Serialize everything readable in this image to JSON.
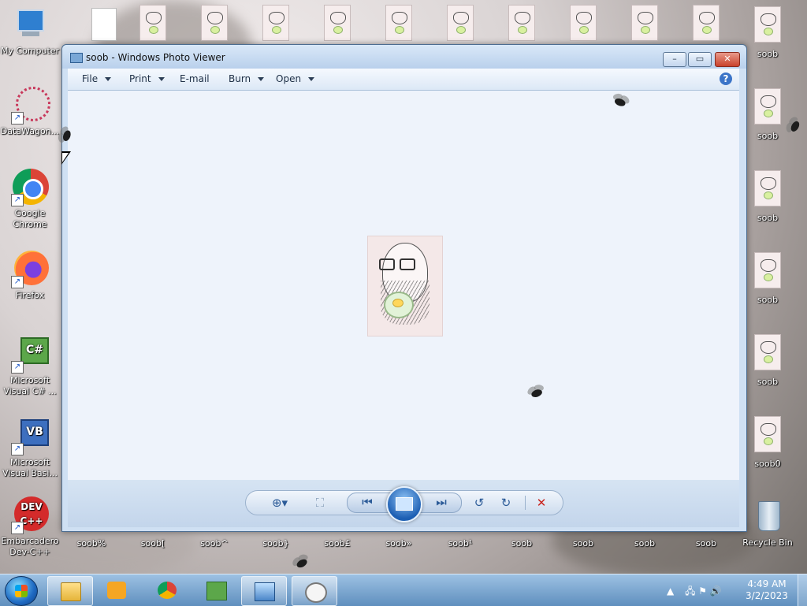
{
  "window": {
    "title": "soob - Windows Photo Viewer",
    "minimize": "–",
    "maximize": "▭",
    "close": "✕"
  },
  "menu": {
    "file": "File",
    "print": "Print",
    "email": "E-mail",
    "burn": "Burn",
    "open": "Open",
    "help": "?"
  },
  "controls": {
    "zoom": "⊕▾",
    "fit": "⛶",
    "previous": "⏮",
    "next": "⏭",
    "rotate_ccw": "↺",
    "rotate_cw": "↻",
    "delete": "✕"
  },
  "desktop": {
    "my_computer": "My Computer",
    "datawagon": "DataWagon...",
    "chrome": "Google Chrome",
    "firefox": "Firefox",
    "vcsharp": "Microsoft Visual C# ...",
    "vbasic": "Microsoft Visual Basi...",
    "devcpp": "Embarcadero Dev-C++",
    "right_col": [
      "soob",
      "soob",
      "soob",
      "soob",
      "soob",
      "soob0"
    ],
    "bottom_row": [
      "soob%",
      "soob[",
      "soob^",
      "soob}",
      "soob£",
      "soob»",
      "soob¹",
      "soob",
      "soob",
      "soob",
      "soob"
    ],
    "recycle_bin": "Recycle Bin"
  },
  "taskbar": {
    "time": "4:49 AM",
    "date": "3/2/2023",
    "tray_arrow": "▲",
    "tray_icons": "🖧 ⚑ 🔊"
  },
  "colors": {
    "titlebar": "#c9dcf2",
    "viewer_bg": "#eef3fb",
    "taskbar": "#6c9ac8",
    "close_red": "#c9422c"
  }
}
